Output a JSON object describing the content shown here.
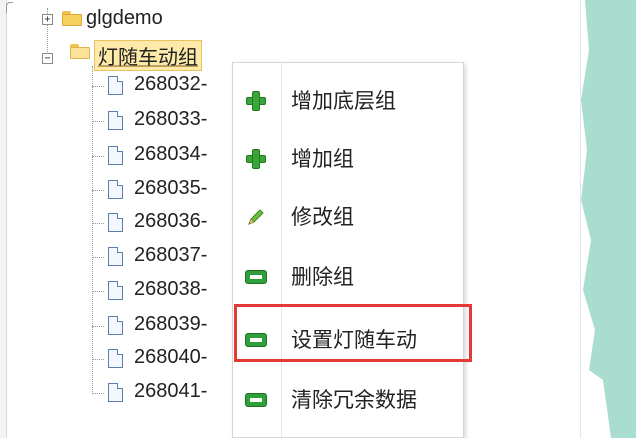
{
  "tree": {
    "nodes": [
      {
        "label": "glgdemo",
        "expander": "+"
      },
      {
        "label": "灯随车动组",
        "expander": "−"
      }
    ],
    "leaves": [
      "268032-",
      "268033-",
      "268034-",
      "268035-",
      "268036-",
      "268037-",
      "268038-",
      "268039-",
      "268040-",
      "268041-"
    ]
  },
  "context_menu": {
    "items": [
      {
        "label": "增加底层组",
        "icon": "plus-icon"
      },
      {
        "label": "增加组",
        "icon": "plus-icon"
      },
      {
        "label": "修改组",
        "icon": "pencil-icon"
      },
      {
        "label": "删除组",
        "icon": "minus-icon"
      },
      {
        "label": "设置灯随车动",
        "icon": "minus-icon",
        "highlighted": true
      },
      {
        "label": "清除冗余数据",
        "icon": "minus-icon"
      }
    ]
  },
  "colors": {
    "highlight_box": "#e53935",
    "selected_bg": "#fde9a8",
    "map_water": "#a9ddd0"
  }
}
